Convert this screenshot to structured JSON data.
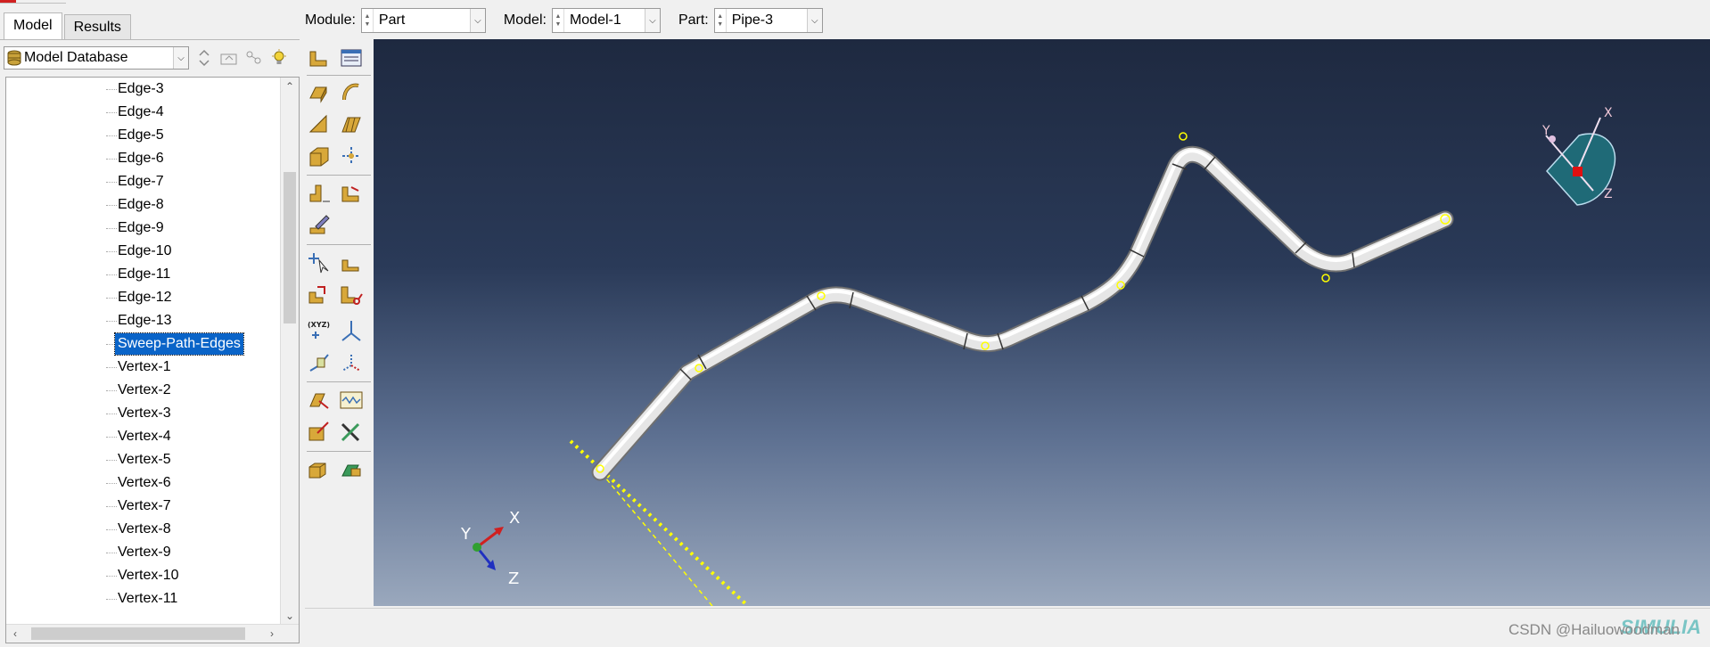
{
  "tabs": [
    {
      "label": "Model",
      "active": true
    },
    {
      "label": "Results",
      "active": false
    }
  ],
  "tree_header": {
    "database_label": "Model Database"
  },
  "tree": {
    "items": [
      "Edge-3",
      "Edge-4",
      "Edge-5",
      "Edge-6",
      "Edge-7",
      "Edge-8",
      "Edge-9",
      "Edge-10",
      "Edge-11",
      "Edge-12",
      "Edge-13",
      "Sweep-Path-Edges",
      "Vertex-1",
      "Vertex-2",
      "Vertex-3",
      "Vertex-4",
      "Vertex-5",
      "Vertex-6",
      "Vertex-7",
      "Vertex-8",
      "Vertex-9",
      "Vertex-10",
      "Vertex-11"
    ],
    "selected": "Sweep-Path-Edges"
  },
  "context_bar": {
    "module_label": "Module:",
    "module_value": "Part",
    "model_label": "Model:",
    "model_value": "Model-1",
    "part_label": "Part:",
    "part_value": "Pipe-3"
  },
  "toolbox": {
    "icons": [
      "create-part-icon",
      "part-manager-icon",
      "solid-extrude-icon",
      "solid-revolve-icon",
      "shell-planar-icon",
      "shell-extrude-icon",
      "solid-sweep-icon",
      "wire-feature-icon",
      "round-fillet-icon",
      "cut-extrude-icon",
      "sketch-edit-icon",
      "partition-edge-icon",
      "datum-plane-icon",
      "merge-tool-icon",
      "cut-tool-icon",
      "datum-point-icon",
      "datum-axis-icon",
      "datum-csys-icon",
      "reference-point-icon",
      "query-icon",
      "wire-path-icon",
      "edit-feature-icon",
      "repair-tools-icon",
      "feature-manager-icon",
      "export-icon"
    ]
  },
  "viewport": {
    "triad_main": {
      "x": "X",
      "y": "Y",
      "z": "Z"
    },
    "triad_view_cube": {
      "x": "X",
      "y": "Y",
      "z": "Z"
    },
    "background_top": "#1e2940",
    "background_bottom": "#9aa8bd",
    "highlight_color": "#ffff00"
  },
  "status": {
    "watermark": "CSDN @Hailuowoodman",
    "brand": "SIMULIA"
  }
}
